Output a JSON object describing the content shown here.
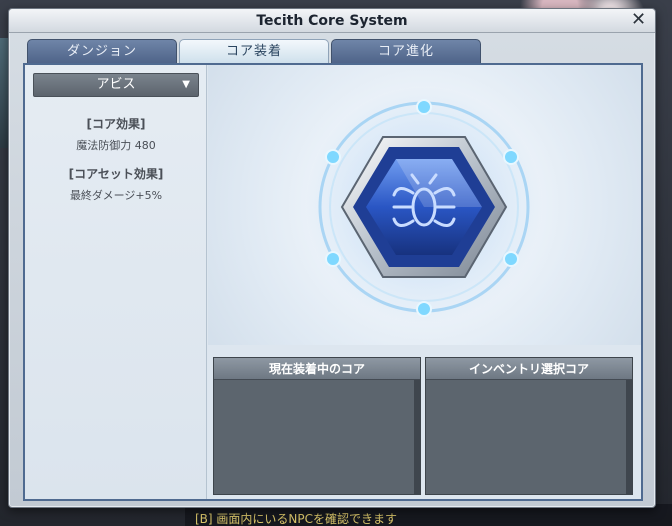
{
  "window": {
    "title": "Tecith Core System",
    "close_label": "✕"
  },
  "tabs": [
    {
      "label": "ダンジョン",
      "active": false
    },
    {
      "label": "コア装着",
      "active": true
    },
    {
      "label": "コア進化",
      "active": false
    }
  ],
  "left_panel": {
    "dropdown_value": "アビス",
    "core_effect_heading": "[コア効果]",
    "core_effect_value": "魔法防御力 480",
    "set_effect_heading": "[コアセット効果]",
    "set_effect_value": "最終ダメージ+5%"
  },
  "slots": {
    "equipped_label": "現在装着中のコア",
    "inventory_label": "インベントリ選択コア"
  },
  "chat": {
    "line": "[B] 画面内にいるNPCを確認できます"
  },
  "colors": {
    "tab_active": "#e4eef6",
    "tab_inactive": "#5c7198",
    "core_blue": "#2f5fc9",
    "frame_border": "#4f6a90"
  },
  "icons": {
    "core": "hexagon-gem-icon",
    "dropdown": "chevron-down-icon",
    "close": "close-icon"
  }
}
